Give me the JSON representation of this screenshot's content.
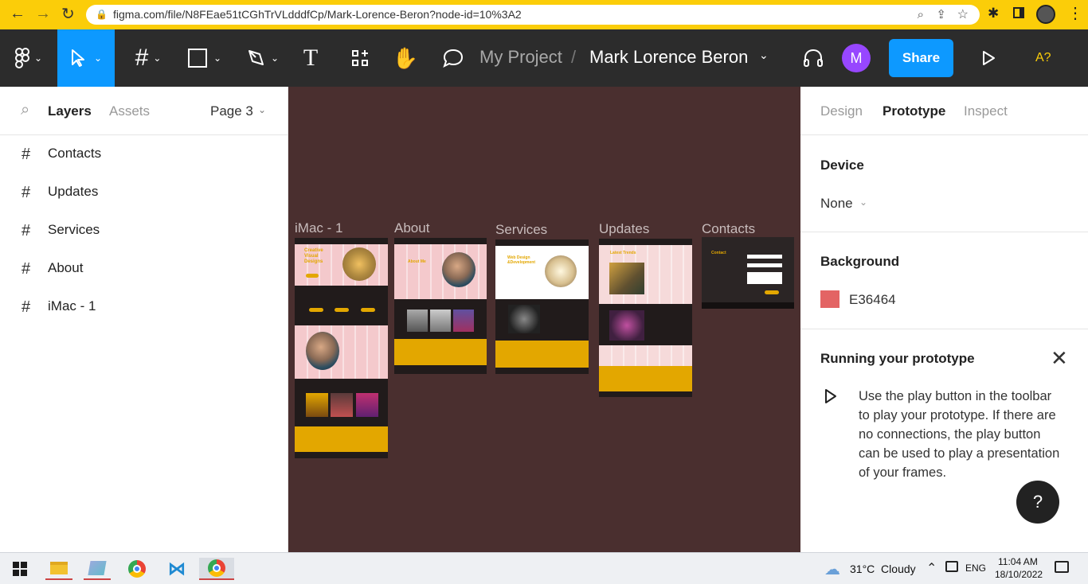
{
  "browser": {
    "url": "figma.com/file/N8FEae51tCGhTrVLdddfCp/Mark-Lorence-Beron?node-id=10%3A2"
  },
  "toolbar": {
    "project": "My Project",
    "separator": "/",
    "file_name": "Mark Lorence Beron",
    "avatar_letter": "M",
    "share_label": "Share",
    "zoom_label": "A?"
  },
  "left_panel": {
    "tabs": [
      "Layers",
      "Assets"
    ],
    "page_selector": "Page 3",
    "layers": [
      "Contacts",
      "Updates",
      "Services",
      "About",
      "iMac - 1"
    ]
  },
  "canvas": {
    "background": "#4a2f2f",
    "frames": [
      "iMac - 1",
      "About",
      "Services",
      "Updates",
      "Contacts"
    ],
    "frame_texts": {
      "hero": "Creative Visual Designs",
      "about_title": "About Me",
      "services_title": "Web Design &Development",
      "updates_title": "Latest Trends",
      "contacts_title": "Contact"
    }
  },
  "right_panel": {
    "tabs": [
      "Design",
      "Prototype",
      "Inspect"
    ],
    "active_tab": "Prototype",
    "device_title": "Device",
    "device_value": "None",
    "background_title": "Background",
    "background_hex": "E36464",
    "background_color": "#e36464",
    "running_title": "Running your prototype",
    "running_text": "Use the play button in the toolbar to play your prototype. If there are no connections, the play button can be used to play a presentation of your frames.",
    "help_label": "?"
  },
  "taskbar": {
    "weather": "31°C  Cloudy",
    "language": "ENG",
    "time": "11:04 AM",
    "date": "18/10/2022"
  }
}
